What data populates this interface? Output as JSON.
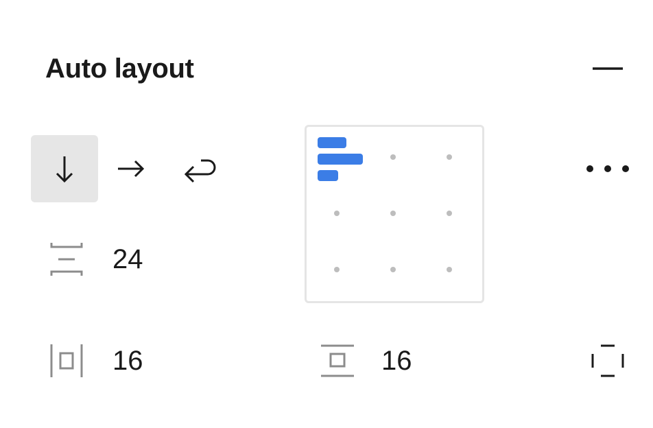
{
  "panel": {
    "title": "Auto layout"
  },
  "direction": {
    "options": [
      {
        "name": "vertical",
        "icon": "arrow-down-icon",
        "active": true
      },
      {
        "name": "horizontal",
        "icon": "arrow-right-icon",
        "active": false
      },
      {
        "name": "wrap",
        "icon": "wrap-arrow-icon",
        "active": false
      }
    ]
  },
  "alignment": {
    "selected": "top-left",
    "accent_color": "#3b7de6"
  },
  "spacing": {
    "gap": "24",
    "horizontal_padding": "16",
    "vertical_padding": "16"
  },
  "icons": {
    "collapse": "minus-icon",
    "more": "more-options-icon",
    "gap": "vertical-gap-icon",
    "horizontal_padding": "horizontal-padding-icon",
    "vertical_padding": "vertical-padding-icon",
    "clip": "padding-box-icon"
  }
}
